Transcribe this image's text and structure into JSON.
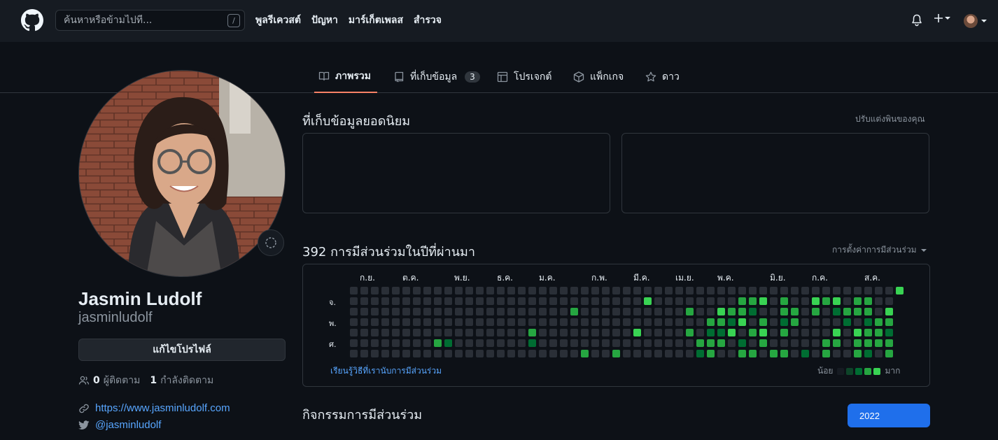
{
  "header": {
    "search_placeholder": "ค้นหาหรือข้ามไปที่...",
    "slash_key": "/",
    "nav": [
      "พูลรีเควสต์",
      "ปัญหา",
      "มาร์เก็ตเพลส",
      "สำรวจ"
    ]
  },
  "tabs": [
    {
      "label": "ภาพรวม",
      "icon": "book-icon"
    },
    {
      "label": "ที่เก็บข้อมูล",
      "icon": "repo-icon",
      "count": "3"
    },
    {
      "label": "โปรเจกต์",
      "icon": "table-icon"
    },
    {
      "label": "แพ็กเกจ",
      "icon": "package-icon"
    },
    {
      "label": "ดาว",
      "icon": "star-icon"
    }
  ],
  "profile": {
    "name": "Jasmin Ludolf",
    "login": "jasminludolf",
    "edit_label": "แก้ไขโปรไฟล์",
    "followers_count": "0",
    "followers_label": "ผู้ติดตาม",
    "following_count": "1",
    "following_label": "กำลังติดตาม",
    "website": "https://www.jasminludolf.com",
    "twitter": "@jasminludolf"
  },
  "main": {
    "popular_title": "ที่เก็บข้อมูลยอดนิยม",
    "customize_label": "ปรับแต่งพินของคุณ",
    "contrib_title": "392 การมีส่วนร่วมในปีที่ผ่านมา",
    "contrib_settings": "การตั้งค่าการมีส่วนร่วม",
    "months": [
      "ก.ย.",
      "ต.ค.",
      "พ.ย.",
      "ธ.ค.",
      "ม.ค.",
      "ก.พ.",
      "มี.ค.",
      "เม.ย.",
      "พ.ค.",
      "มิ.ย.",
      "ก.ค.",
      "ส.ค."
    ],
    "days": [
      "จ.",
      "พ.",
      "ศ."
    ],
    "learn_label": "เรียนรู้วิธีที่เรานับการมีส่วนร่วม",
    "legend_less": "น้อย",
    "legend_more": "มาก",
    "activity_title": "กิจกรรมการมีส่วนร่วม",
    "year": "2022"
  },
  "colors": {
    "level0": "#161b22",
    "level1": "#0e4429",
    "level2": "#006d32",
    "level3": "#26a641",
    "level4": "#39d353",
    "accent": "#1f6feb",
    "tab_underline": "#f78166"
  }
}
